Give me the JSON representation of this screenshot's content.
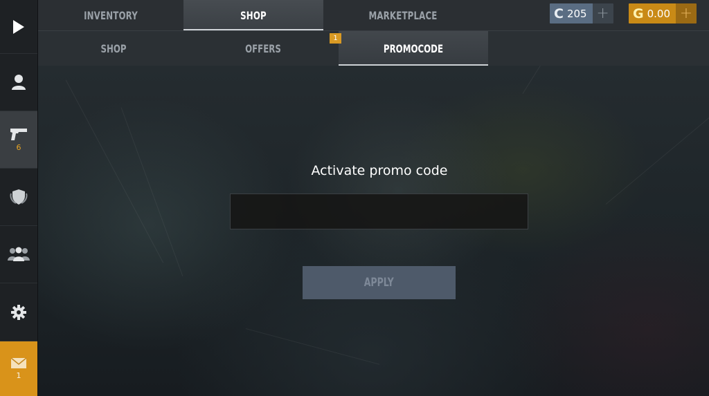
{
  "top_tabs": [
    {
      "label": "INVENTORY",
      "active": false
    },
    {
      "label": "SHOP",
      "active": true
    },
    {
      "label": "MARKETPLACE",
      "active": false
    }
  ],
  "currency": {
    "silver": {
      "glyph": "C",
      "amount": "205",
      "plus": "+",
      "color": "#5a6d83"
    },
    "gold": {
      "glyph": "G",
      "amount": "0.00",
      "plus": "+",
      "color": "#c98a16"
    }
  },
  "sub_tabs": [
    {
      "label": "SHOP",
      "active": false
    },
    {
      "label": "OFFERS",
      "active": false,
      "badge": "1"
    },
    {
      "label": "PROMOCODE",
      "active": true
    }
  ],
  "sidebar": {
    "items": [
      {
        "icon": "play-icon"
      },
      {
        "icon": "profile-icon"
      },
      {
        "icon": "pistol-icon",
        "count": "6",
        "active": true
      },
      {
        "icon": "shield-icon"
      },
      {
        "icon": "friends-icon"
      },
      {
        "icon": "gear-icon"
      },
      {
        "icon": "mail-icon",
        "count": "1"
      }
    ]
  },
  "promo": {
    "title": "Activate promo code",
    "input_value": "",
    "apply_label": "APPLY"
  },
  "colors": {
    "accent": "#d9931a",
    "button": "#4e5a6a"
  }
}
